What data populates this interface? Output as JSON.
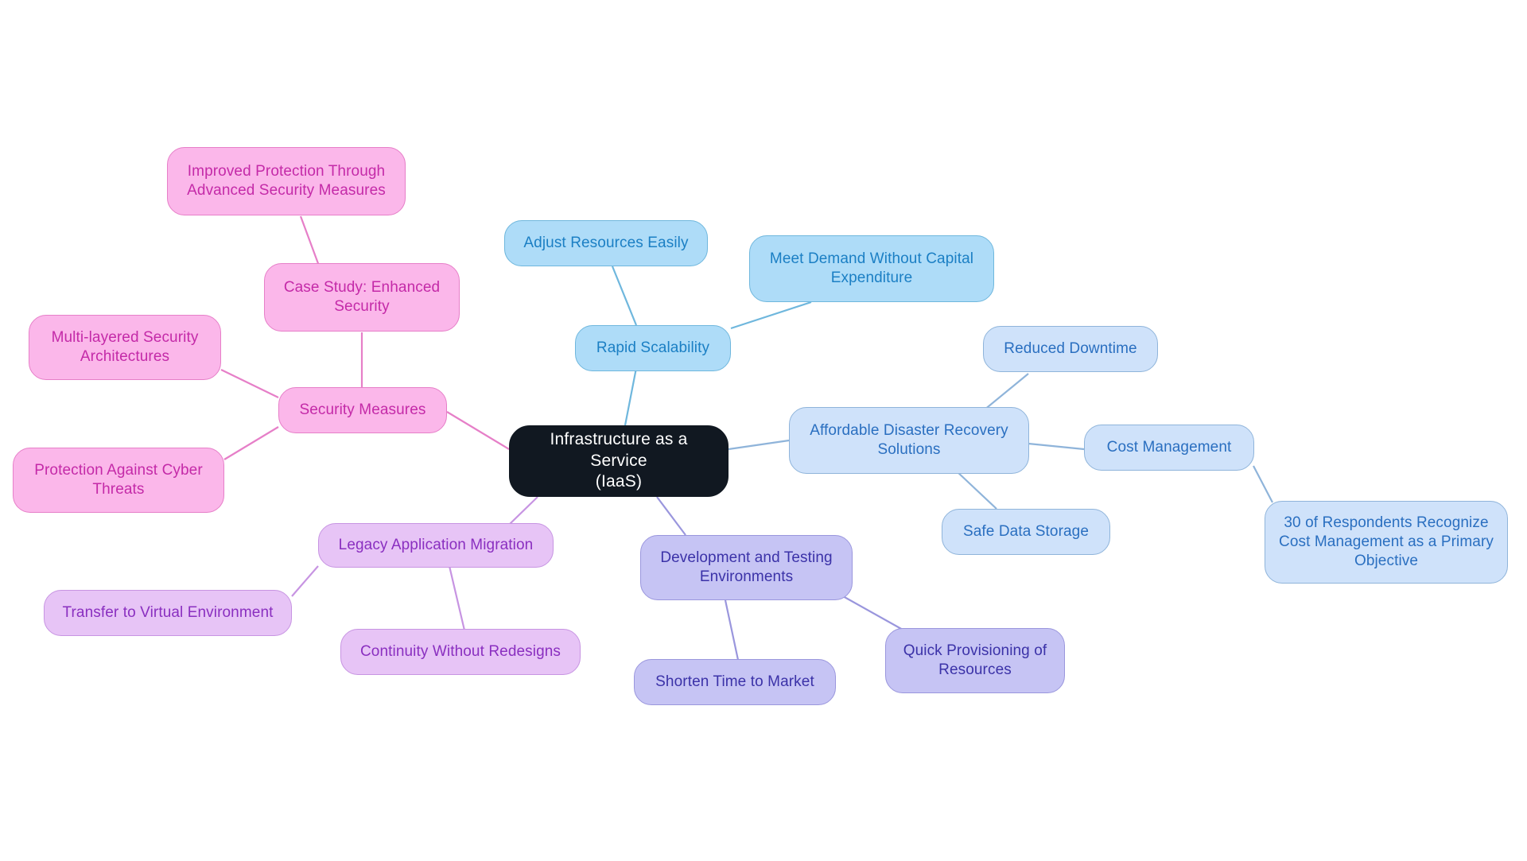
{
  "diagram": {
    "type": "mindmap",
    "title": "Infrastructure as a Service (IaaS)",
    "background": "#ffffff",
    "palette": {
      "root_fill": "#111821",
      "root_text": "#ffffff",
      "sky_fill": "#aedcf8",
      "sky_border": "#6fb7dd",
      "sky_text": "#1b7fc4",
      "blue_fill": "#cfe2fa",
      "blue_border": "#8fb4da",
      "blue_text": "#2a6fc0",
      "magenta_fill": "#fbb7ea",
      "magenta_border": "#e67fc8",
      "magenta_text": "#c42aa8",
      "violet_fill": "#c6c4f4",
      "violet_border": "#9a96dd",
      "violet_text": "#3b32a8",
      "lilac_fill": "#e7c4f6",
      "lilac_border": "#c794e2",
      "lilac_text": "#8a2fc0"
    }
  },
  "nodes": {
    "root": {
      "label": "Infrastructure as a Service\n(IaaS)"
    },
    "rapid_scalability": {
      "label": "Rapid Scalability"
    },
    "adjust_resources": {
      "label": "Adjust Resources Easily"
    },
    "meet_demand": {
      "label": "Meet Demand Without Capital\nExpenditure"
    },
    "disaster_recovery": {
      "label": "Affordable Disaster Recovery\nSolutions"
    },
    "reduced_downtime": {
      "label": "Reduced Downtime"
    },
    "safe_data_storage": {
      "label": "Safe Data Storage"
    },
    "cost_management": {
      "label": "Cost Management"
    },
    "respondents_stat": {
      "label": "30 of Respondents Recognize\nCost Management as a Primary\nObjective"
    },
    "security_measures": {
      "label": "Security Measures"
    },
    "improved_protection": {
      "label": "Improved Protection Through\nAdvanced Security Measures"
    },
    "case_study": {
      "label": "Case Study: Enhanced\nSecurity"
    },
    "multi_layered": {
      "label": "Multi-layered Security\nArchitectures"
    },
    "cyber_threats": {
      "label": "Protection Against Cyber\nThreats"
    },
    "legacy_migration": {
      "label": "Legacy Application Migration"
    },
    "transfer_virtual": {
      "label": "Transfer to Virtual Environment"
    },
    "continuity": {
      "label": "Continuity Without Redesigns"
    },
    "dev_test": {
      "label": "Development and Testing\nEnvironments"
    },
    "shorten_time": {
      "label": "Shorten Time to Market"
    },
    "quick_provisioning": {
      "label": "Quick Provisioning of\nResources"
    }
  },
  "chart_data": {
    "type": "diagram",
    "title": "Infrastructure as a Service (IaaS)",
    "root": "Infrastructure as a Service (IaaS)",
    "branches": [
      {
        "name": "Rapid Scalability",
        "color": "#aedcf8",
        "children": [
          "Adjust Resources Easily",
          "Meet Demand Without Capital Expenditure"
        ]
      },
      {
        "name": "Affordable Disaster Recovery Solutions",
        "color": "#cfe2fa",
        "children": [
          "Reduced Downtime",
          "Safe Data Storage",
          "Cost Management"
        ],
        "grandchildren": {
          "Cost Management": [
            "30 of Respondents Recognize Cost Management as a Primary Objective"
          ]
        }
      },
      {
        "name": "Security Measures",
        "color": "#fbb7ea",
        "children": [
          "Case Study: Enhanced Security",
          "Multi-layered Security Architectures",
          "Protection Against Cyber Threats"
        ],
        "grandchildren": {
          "Case Study: Enhanced Security": [
            "Improved Protection Through Advanced Security Measures"
          ]
        }
      },
      {
        "name": "Legacy Application Migration",
        "color": "#e7c4f6",
        "children": [
          "Transfer to Virtual Environment",
          "Continuity Without Redesigns"
        ]
      },
      {
        "name": "Development and Testing Environments",
        "color": "#c6c4f4",
        "children": [
          "Shorten Time to Market",
          "Quick Provisioning of Resources"
        ]
      }
    ]
  }
}
